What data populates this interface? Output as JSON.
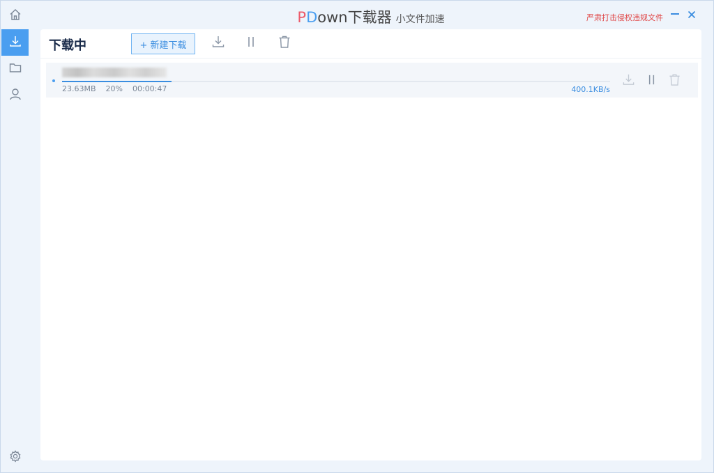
{
  "app": {
    "title_p": "P",
    "title_d": "D",
    "title_rest": "own下载器",
    "subtitle": "小文件加速",
    "notice": "严肃打击侵权违规文件"
  },
  "sidebar": {
    "items": [
      {
        "icon": "home-icon"
      },
      {
        "icon": "download-icon",
        "active": true
      },
      {
        "icon": "folder-icon"
      },
      {
        "icon": "user-icon"
      },
      {
        "icon": "gear-icon"
      }
    ]
  },
  "toolbar": {
    "title": "下载中",
    "new_download_label": "+ 新建下载",
    "icons": [
      "download-icon",
      "pause-icon",
      "trash-icon"
    ]
  },
  "tasks": [
    {
      "name": "",
      "size": "23.63MB",
      "percent": "20%",
      "progress": 0.2,
      "time": "00:00:47",
      "speed": "400.1KB/s"
    }
  ],
  "colors": {
    "accent": "#4a9ef0",
    "brand_p": "#ec5a6a",
    "notice": "#e04848",
    "title_dark": "#1a2b4a"
  }
}
